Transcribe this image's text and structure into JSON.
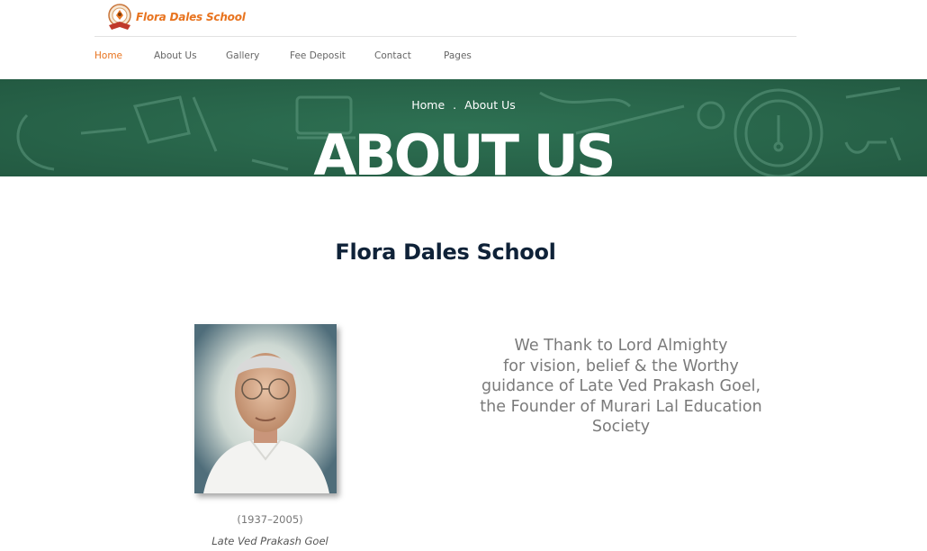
{
  "header": {
    "logo_text": "Flora Dales School",
    "nav": [
      {
        "label": "Home",
        "active": true
      },
      {
        "label": "About Us",
        "active": false
      },
      {
        "label": "Gallery",
        "active": false
      },
      {
        "label": "Fee Deposit",
        "active": false
      },
      {
        "label": "Contact",
        "active": false
      },
      {
        "label": "Pages",
        "active": false
      }
    ]
  },
  "banner": {
    "breadcrumb": {
      "home": "Home",
      "separator": ".",
      "current": "About Us"
    },
    "title": "ABOUT US"
  },
  "content": {
    "heading": "Flora Dales School",
    "portrait_caption_years": "(1937–2005)",
    "portrait_caption_name": "Late Ved Prakash Goel",
    "tribute_lines": [
      "We Thank to Lord Almighty",
      "for vision, belief & the Worthy",
      "guidance of Late Ved Prakash Goel,",
      "the Founder of Murari Lal Education",
      "Society"
    ]
  },
  "colors": {
    "accent": "#e8731e",
    "banner": "#2a6a4e",
    "heading": "#0f2238",
    "muted_text": "#7a7a7a"
  }
}
